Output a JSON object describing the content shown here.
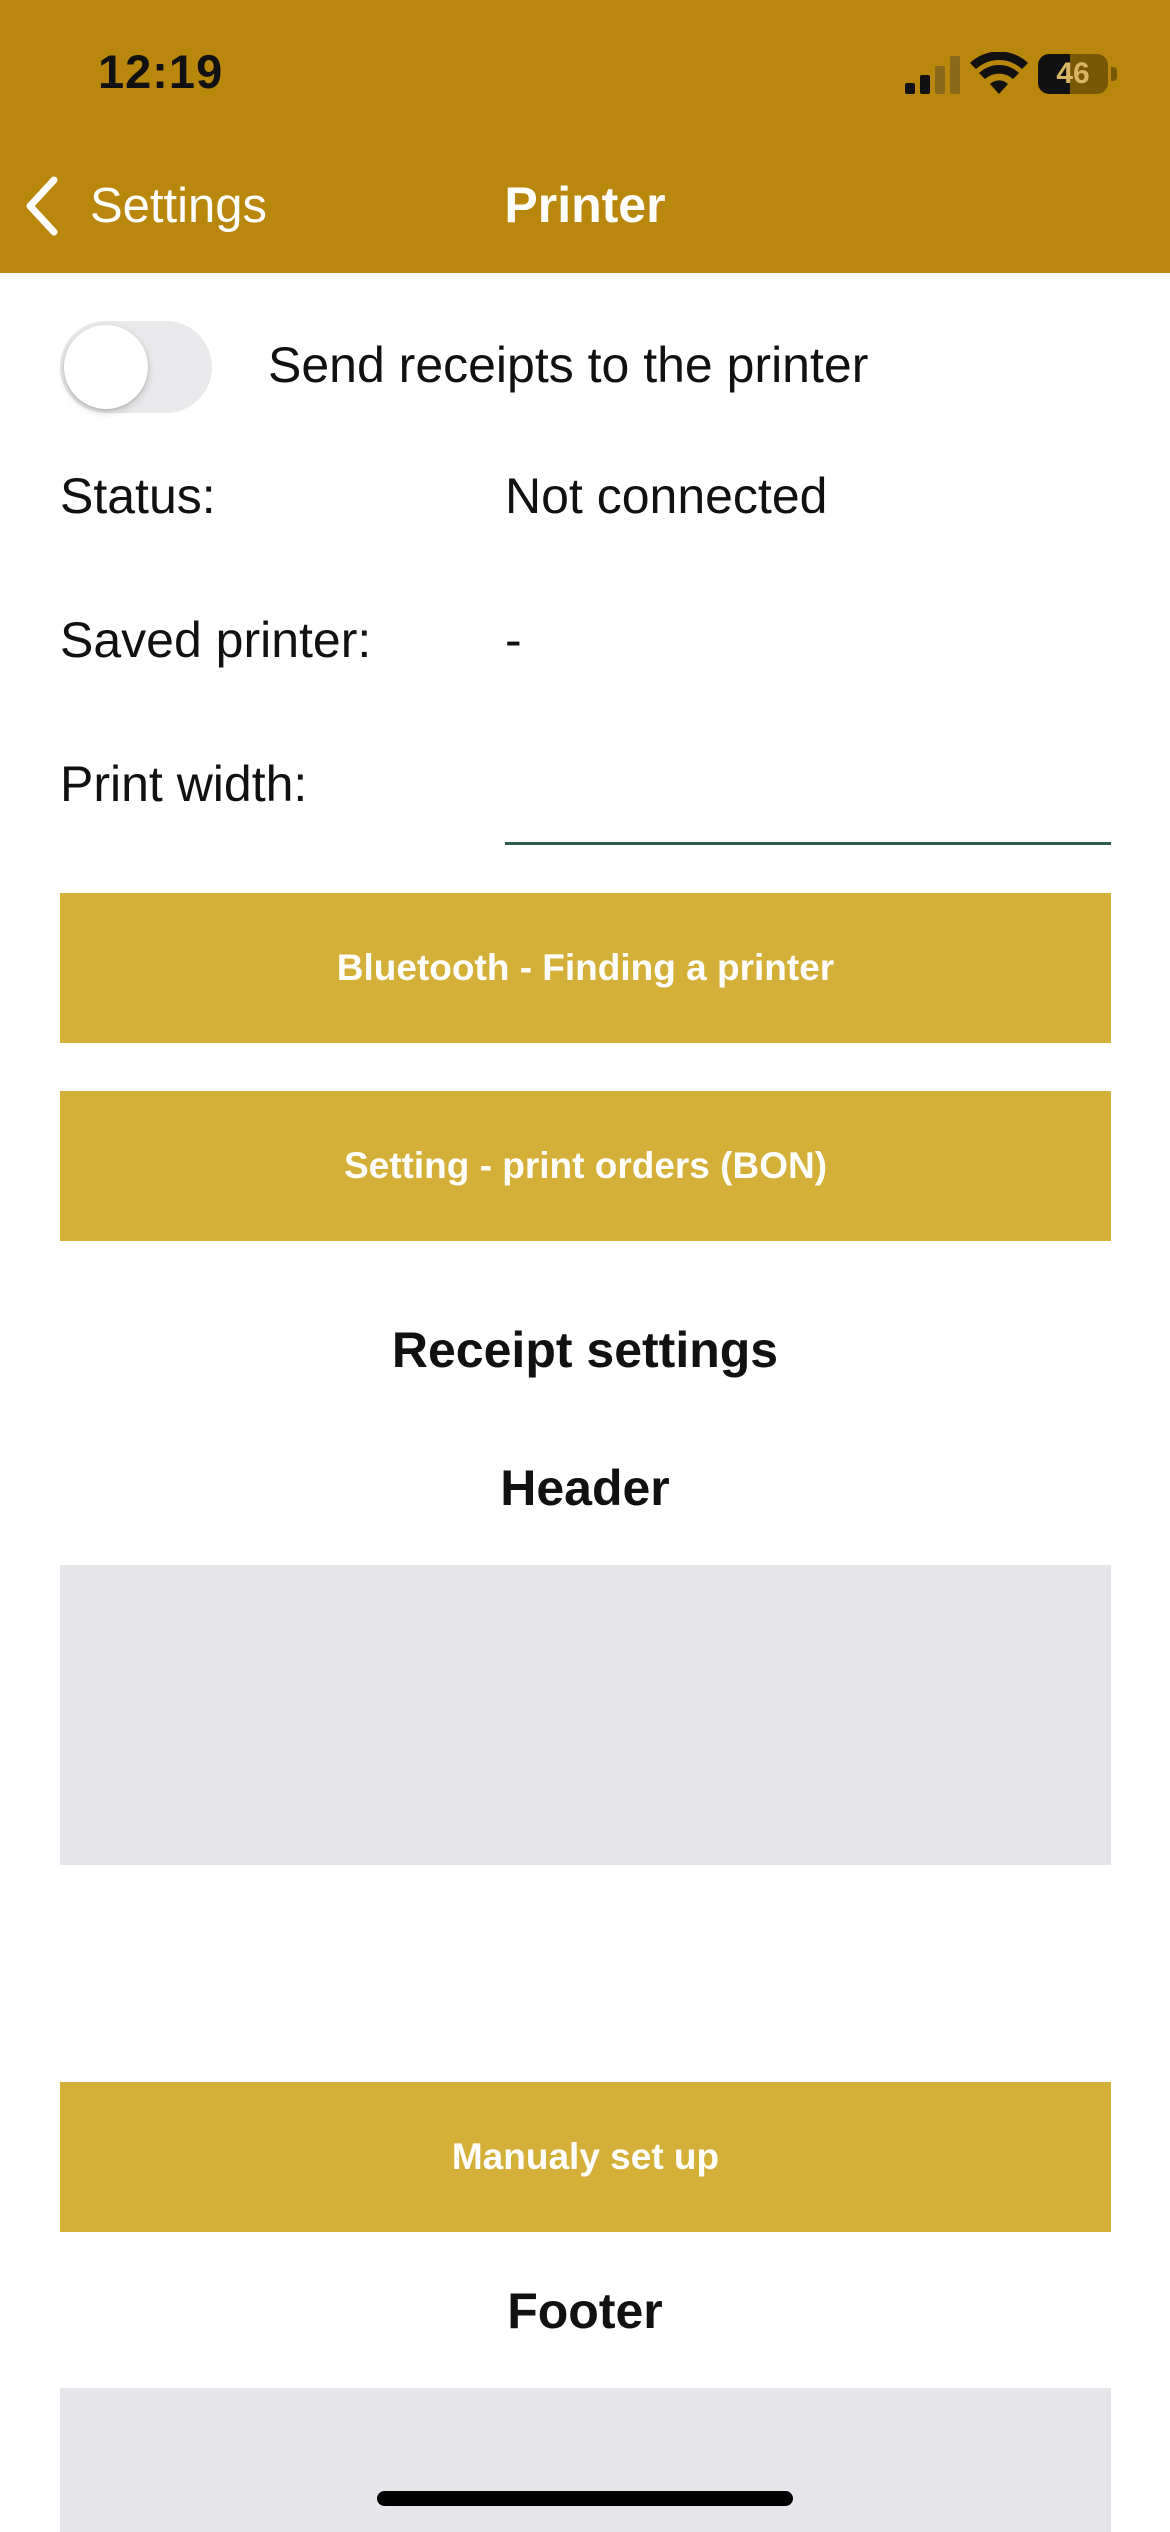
{
  "status_bar": {
    "time": "12:19",
    "battery_level": "46",
    "battery_fraction": 0.46,
    "signal_bars_active": 2,
    "signal_bars_total": 4
  },
  "nav": {
    "back_label": "Settings",
    "title": "Printer",
    "back_icon": "chevron-left-icon"
  },
  "receipt_toggle": {
    "label": "Send receipts to the printer",
    "on": false
  },
  "status": {
    "label": "Status:",
    "value": "Not connected"
  },
  "saved_printer": {
    "label": "Saved printer:",
    "value": "-"
  },
  "print_width": {
    "label": "Print width:",
    "value": ""
  },
  "buttons": {
    "bluetooth": "Bluetooth - Finding a printer",
    "print_orders": "Setting - print orders (BON)",
    "manual_setup": "Manualy set up"
  },
  "receipt_settings": {
    "title": "Receipt settings",
    "header_title": "Header",
    "header_value": "",
    "footer_title": "Footer",
    "footer_value": ""
  },
  "colors": {
    "nav_background": "#b8870c",
    "button_background": "#d4b038",
    "button_text": "#ffffff",
    "field_background": "#e5e5ea",
    "input_underline": "#2f5b4c"
  }
}
